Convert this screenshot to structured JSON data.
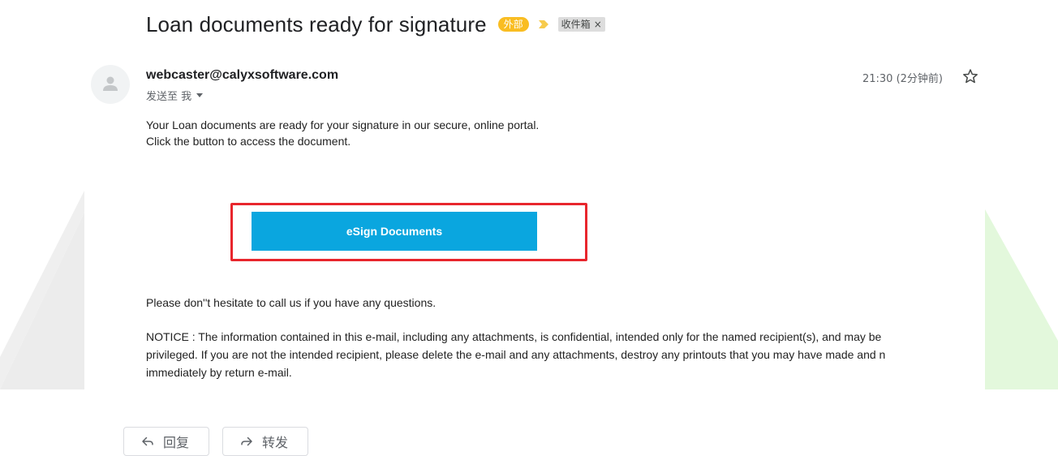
{
  "subject": "Loan documents ready for signature",
  "badges": {
    "external": "外部",
    "label": "收件箱",
    "label_close": "×"
  },
  "sender": {
    "email": "webcaster@calyxsoftware.com",
    "recipient_line": "发送至 我"
  },
  "timestamp": "21:30 (2分钟前)",
  "body": {
    "line1": "Your Loan documents are ready for your signature in our secure, online portal.",
    "line2": "Click the button to access the document.",
    "cta_label": "eSign Documents",
    "questions": "Please don''t hesitate to call us if you have any questions.",
    "notice": [
      "NOTICE : The information contained in this e-mail, including any attachments, is confidential, intended only for the named recipient(s), and may be",
      "privileged. If you are not the intended recipient, please delete the e-mail and any attachments, destroy any printouts that you may have made and n",
      "immediately by return e-mail."
    ]
  },
  "actions": {
    "reply": "回复",
    "forward": "转发"
  },
  "colors": {
    "accent_button": "#0aa6df",
    "highlight_border": "#e8262d",
    "external_badge": "#f9bd22",
    "importance_marker": "#f7cb4d",
    "bg_left_wedge": "#ececec",
    "bg_right_wedge": "#e6f9e0"
  },
  "icons": {
    "avatar": "person-icon",
    "importance": "importance-marker-icon",
    "star": "star-icon",
    "reply": "reply-arrow-icon",
    "forward": "forward-arrow-icon"
  }
}
